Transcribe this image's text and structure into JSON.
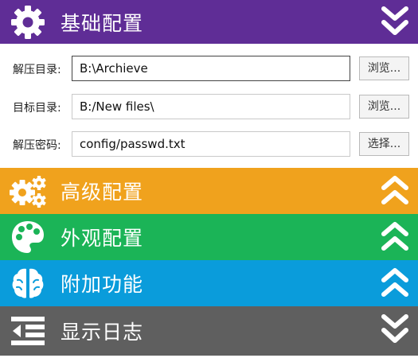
{
  "panels": {
    "basic": {
      "title": "基础配置",
      "icon": "gear-icon",
      "state": "expanded",
      "color": "#5f2d96"
    },
    "advanced": {
      "title": "高级配置",
      "icon": "gears-icon",
      "state": "collapsed",
      "color": "#f0a21d"
    },
    "appearance": {
      "title": "外观配置",
      "icon": "palette-icon",
      "state": "collapsed",
      "color": "#1bb457"
    },
    "addons": {
      "title": "附加功能",
      "icon": "brain-icon",
      "state": "collapsed",
      "color": "#0a9cdb"
    },
    "log": {
      "title": "显示日志",
      "icon": "indent-list-icon",
      "state": "expanded",
      "color": "#5f5f5f"
    }
  },
  "basic_form": {
    "extract_dir": {
      "label": "解压目录:",
      "value": "B:\\Archieve",
      "button": "浏览..."
    },
    "target_dir": {
      "label": "目标目录:",
      "value": "B:/New files\\",
      "button": "浏览..."
    },
    "password": {
      "label": "解压密码:",
      "value": "config/passwd.txt",
      "button": "选择..."
    }
  }
}
